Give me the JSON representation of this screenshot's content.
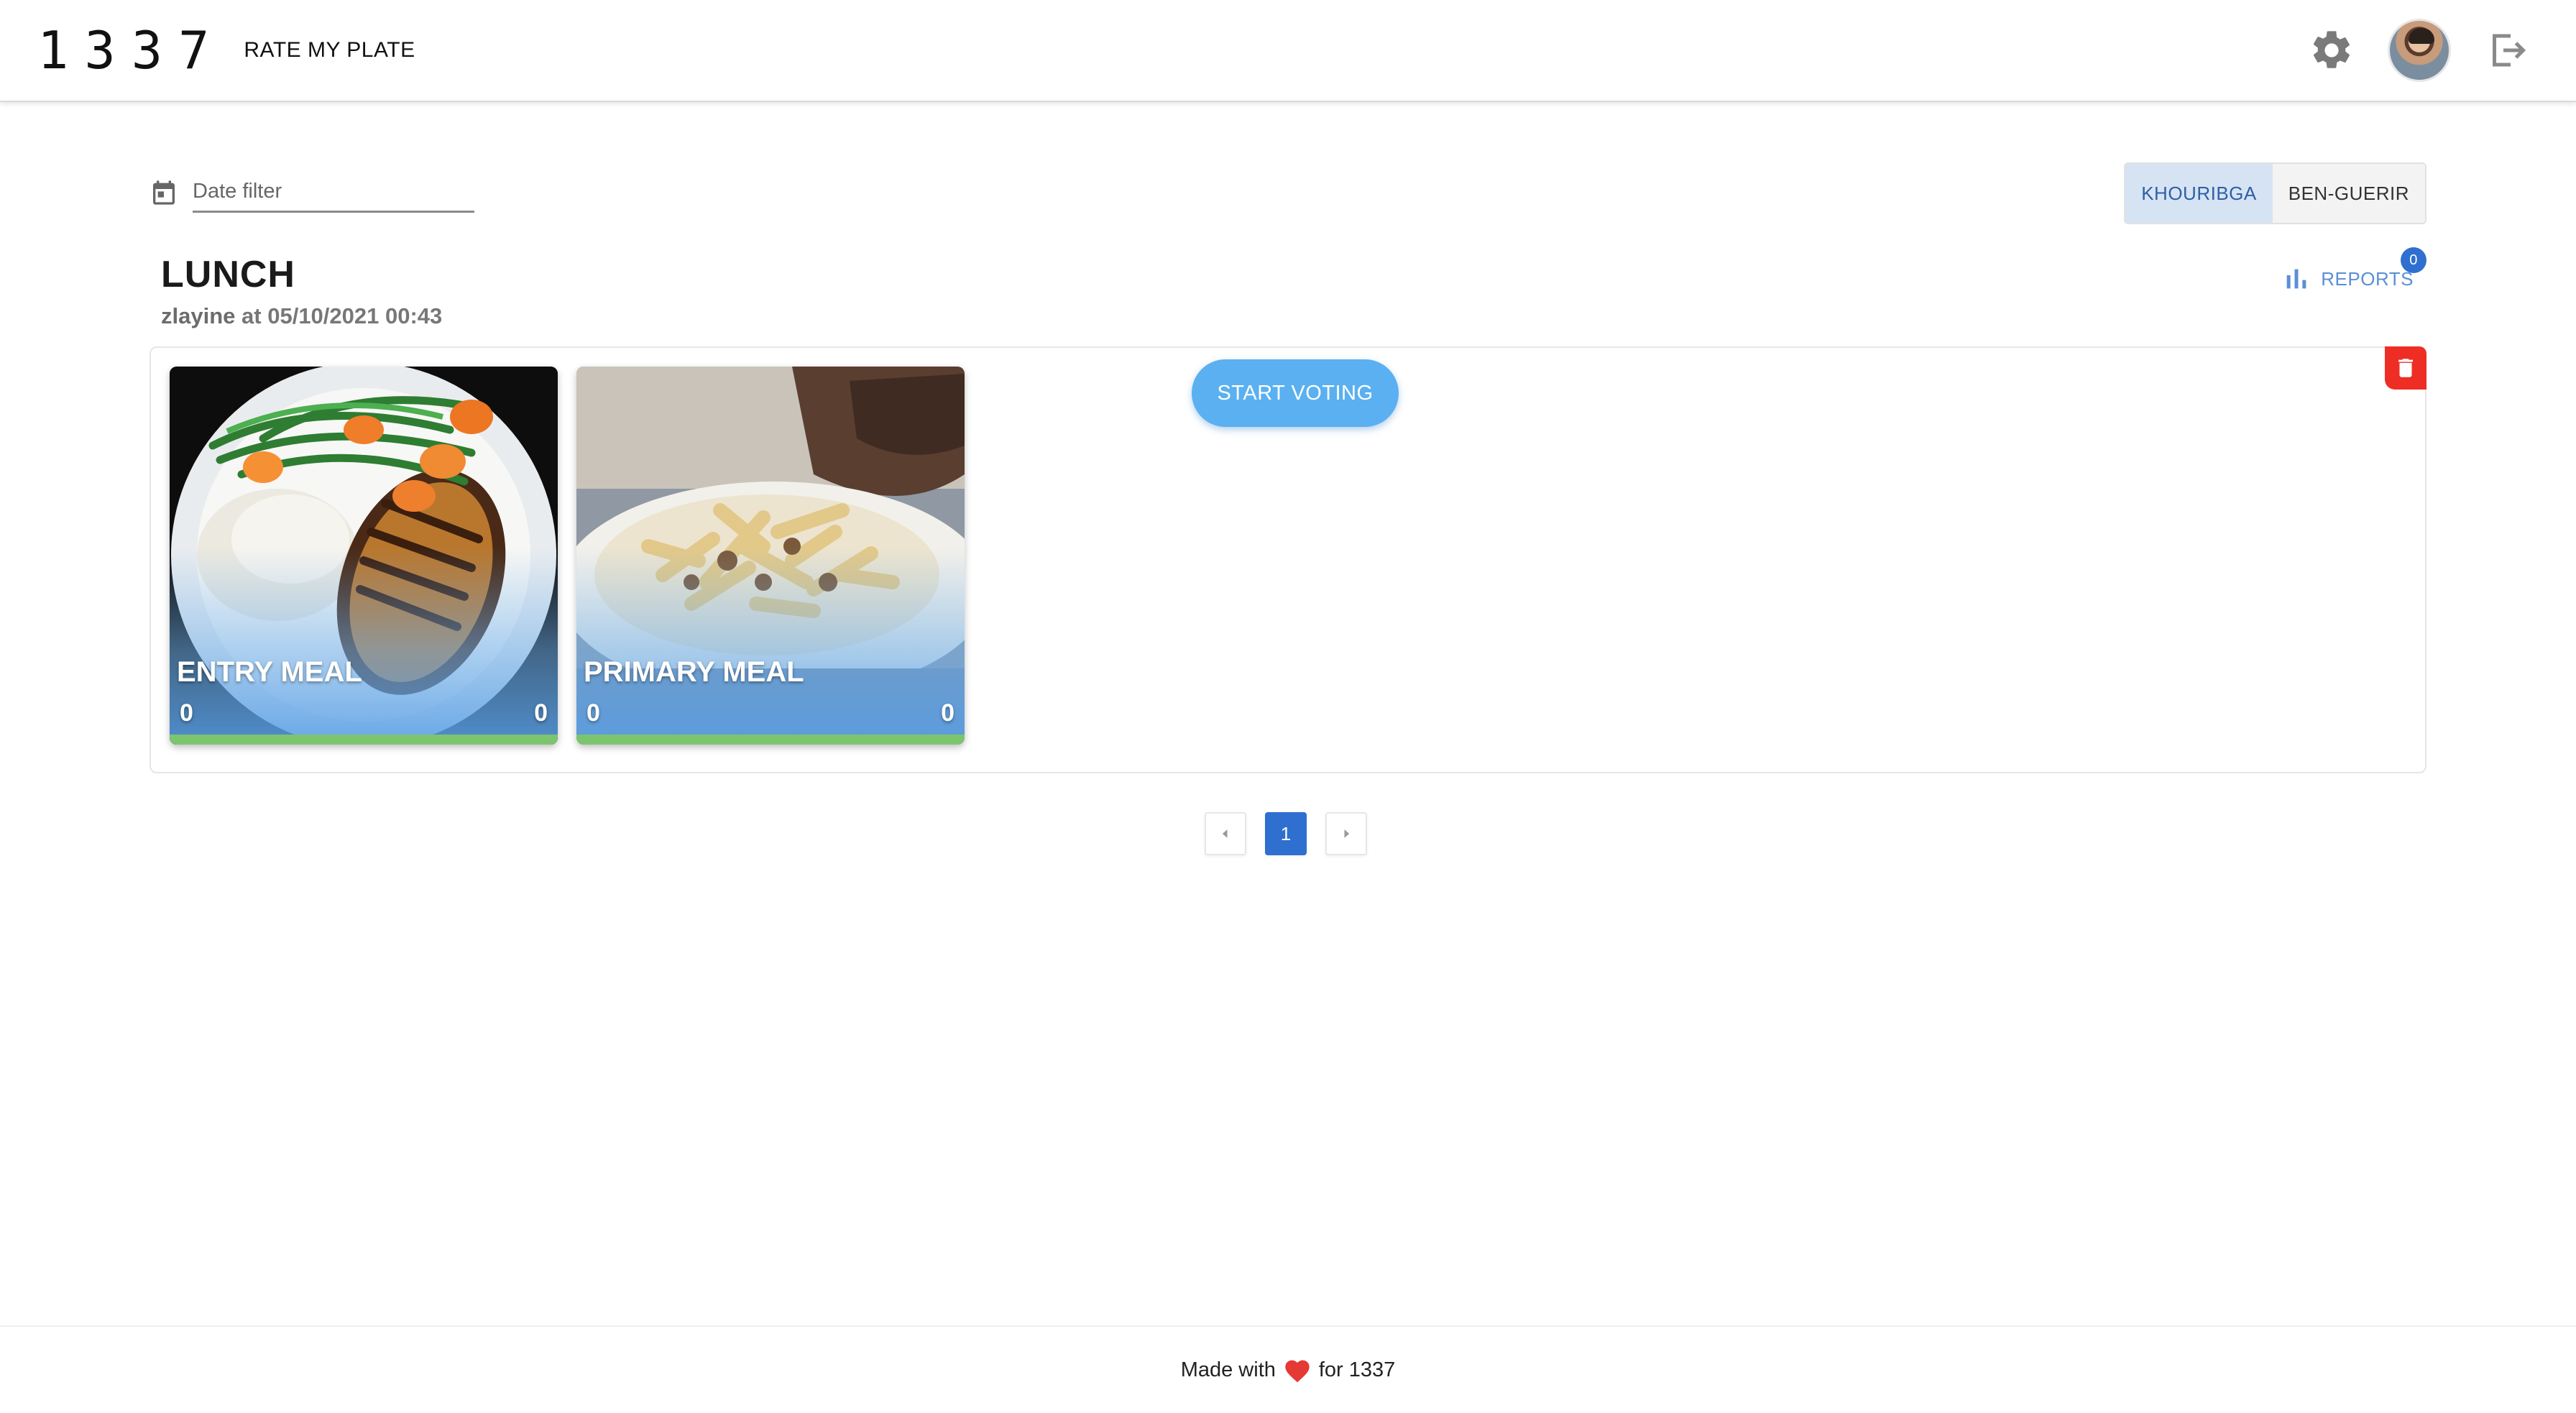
{
  "header": {
    "logo_mark": "1337",
    "app_name": "RATE MY PLATE",
    "icons": [
      "gear-icon",
      "avatar",
      "logout-icon"
    ]
  },
  "filter": {
    "placeholder": "Date filter",
    "value": ""
  },
  "campuses": [
    {
      "label": "KHOURIBGA",
      "active": true
    },
    {
      "label": "BEN-GUERIR",
      "active": false
    }
  ],
  "meal": {
    "title": "LUNCH",
    "author": "zlayine",
    "meta_connector": "at",
    "datetime": "05/10/2021 00:43",
    "reports_label": "REPORTS",
    "reports_count": "0",
    "start_voting_label": "START VOTING",
    "dishes": [
      {
        "name": "ENTRY MEAL",
        "score_left": "0",
        "score_right": "0"
      },
      {
        "name": "PRIMARY MEAL",
        "score_left": "0",
        "score_right": "0"
      }
    ]
  },
  "pagination": {
    "current_page": "1"
  },
  "footer": {
    "made_with": "Made with",
    "for_text": "for 1337"
  },
  "colors": {
    "accent_blue": "#2f6fcf",
    "start_voting": "#5ab0f0",
    "delete_red": "#ee2e24",
    "progress_green": "#7cc56f"
  }
}
